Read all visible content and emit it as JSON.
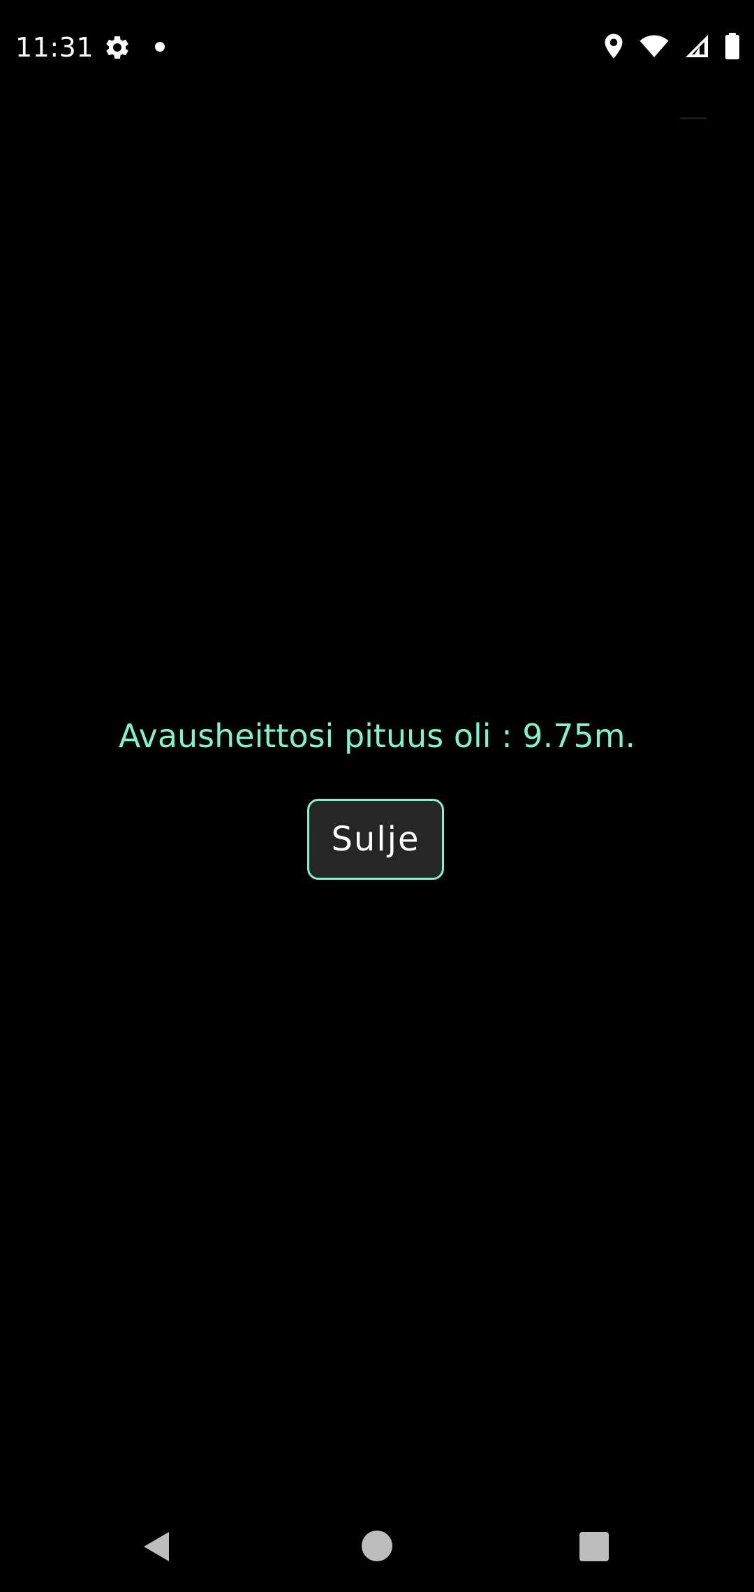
{
  "status_bar": {
    "time": "11:31",
    "icons": [
      "gear-icon",
      "notification-dot-icon",
      "location-icon",
      "wifi-icon",
      "signal-icon",
      "battery-icon"
    ]
  },
  "dialog": {
    "message": "Avausheittosi pituus oli : 9.75m.",
    "close_label": "Sulje"
  },
  "nav_bar": {
    "icons": [
      "back-icon",
      "home-icon",
      "recents-icon"
    ]
  },
  "colors": {
    "background": "#000000",
    "accent": "#7ff2cf",
    "button_bg": "#262626",
    "nav_icons": "#bdbdbd"
  }
}
